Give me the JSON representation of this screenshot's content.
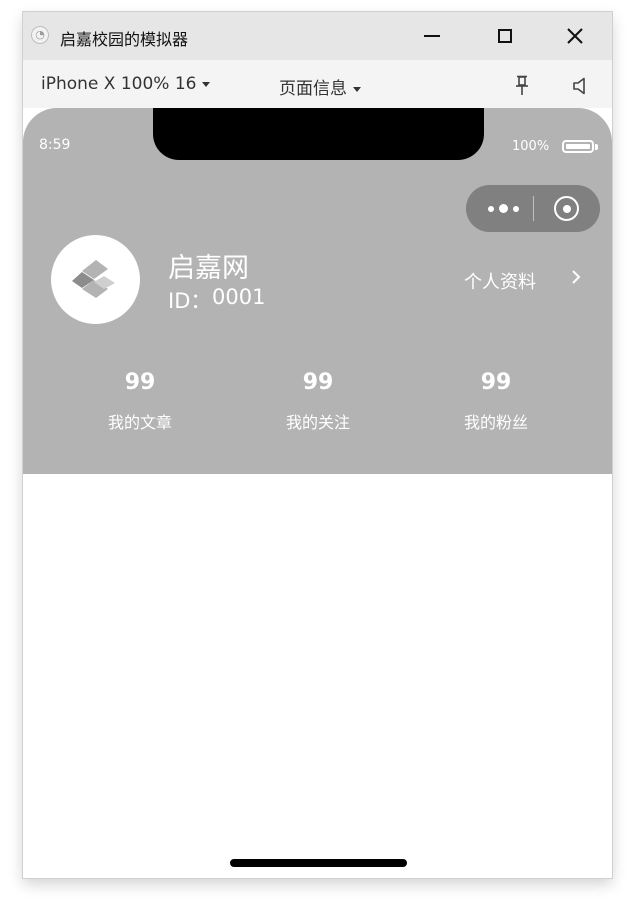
{
  "window": {
    "title": "启嘉校园的模拟器",
    "controls": {
      "minimize": "minimize-icon",
      "maximize": "maximize-icon",
      "close": "close-icon"
    }
  },
  "toolbar": {
    "device": "iPhone X 100% 16",
    "page_info": "页面信息",
    "icons": [
      "pin-icon",
      "speaker-icon"
    ]
  },
  "status_bar": {
    "time": "8:59",
    "battery": "100%"
  },
  "capsule": {
    "icons": [
      "more-dots-icon",
      "target-icon"
    ]
  },
  "profile": {
    "name": "启嘉网",
    "id_label": "ID：",
    "id_value": "0001",
    "profile_link": "个人资料"
  },
  "stats": [
    {
      "value": "99",
      "label": "我的文章"
    },
    {
      "value": "99",
      "label": "我的关注"
    },
    {
      "value": "99",
      "label": "我的粉丝"
    }
  ],
  "colors": {
    "header_bg": "#b3b3b3",
    "capsule_bg": "#808080",
    "titlebar_bg": "#e6e6e6",
    "toolbar_bg": "#f4f4f4"
  }
}
